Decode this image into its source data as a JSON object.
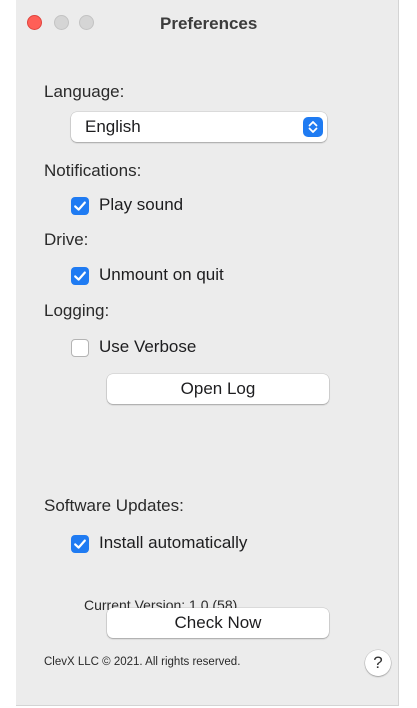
{
  "window": {
    "title": "Preferences"
  },
  "language": {
    "label": "Language:",
    "selected": "English"
  },
  "notifications": {
    "label": "Notifications:",
    "play_sound_label": "Play sound",
    "play_sound_checked": true
  },
  "drive": {
    "label": "Drive:",
    "unmount_label": "Unmount on quit",
    "unmount_checked": true
  },
  "logging": {
    "label": "Logging:",
    "verbose_label": "Use Verbose",
    "verbose_checked": false,
    "open_log_label": "Open Log"
  },
  "updates": {
    "label": "Software Updates:",
    "install_label": "Install automatically",
    "install_checked": true,
    "version_text": "Current Version:  1.0 (58)",
    "check_now_label": "Check Now"
  },
  "footer": {
    "copyright": "ClevX LLC © 2021. All rights reserved.",
    "help_label": "?"
  },
  "colors": {
    "accent": "#1f7bf2",
    "close": "#ff5f57",
    "window_bg": "#ececec"
  }
}
